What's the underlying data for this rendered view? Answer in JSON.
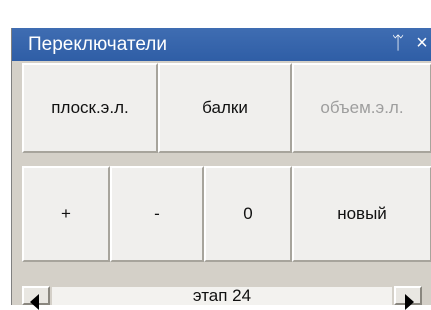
{
  "panel": {
    "title": "Переключатели",
    "pin_glyph": "ᛠ",
    "close_glyph": "×"
  },
  "row1": {
    "flat_elements": "плоск.э.л.",
    "beams": "балки",
    "volume_elements": "объем.э.л."
  },
  "row2": {
    "plus": "+",
    "minus": "-",
    "zero": "0",
    "new": "новый"
  },
  "stage": {
    "label": "этап 24"
  }
}
